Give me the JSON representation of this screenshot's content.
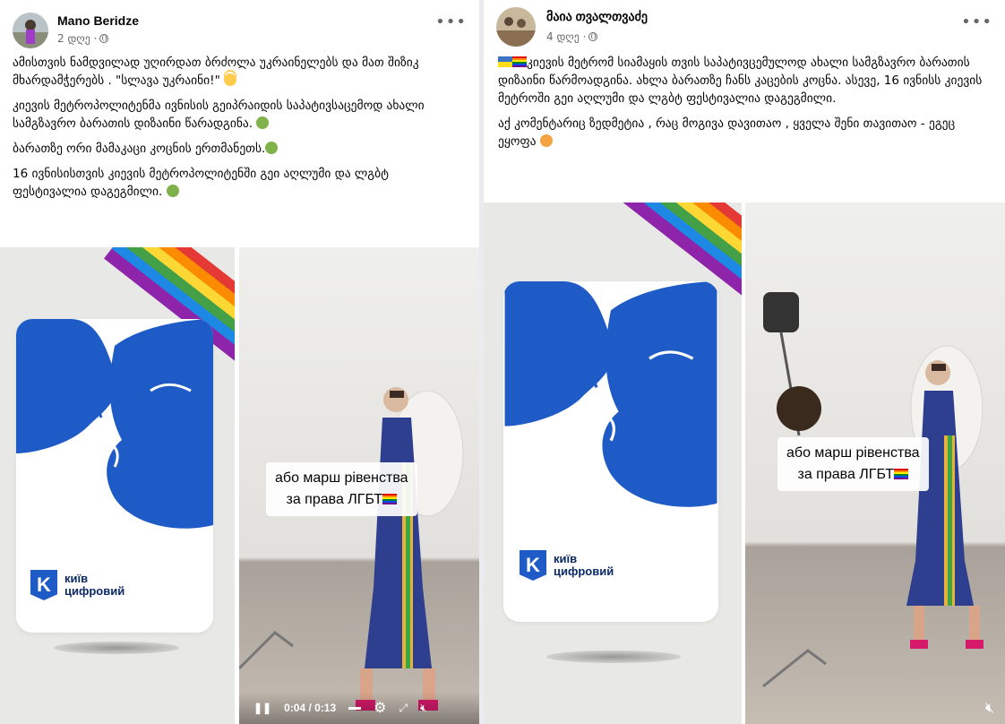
{
  "posts": [
    {
      "author": "Mano Beridze",
      "time": "2 დღე ·",
      "paragraphs": [
        "ამისთვის ნამდვილად  უღირდათ ბრძოლა უკრაინელებს და მათ  შიზიკ მხარდამჭერებს . \"სლავა  უკრაინი!\"",
        " კიევის მეტროპოლიტენმა ივნისის გეიპრაიდის საპატივსაცემოდ ახალი სამგზავრო ბარათის დიზაინი წარადგინა.",
        " ბარათზე ორი  მამაკაცი   კოცნის  ერთმანეთს.",
        " 16 ივნისისთვის  კიევის მეტროპოლიტენში  გეი აღლუმი და ლგბტ ფესტივალია დაგეგმილი."
      ],
      "caption_line1": "або марш рівенства",
      "caption_line2": "за права ЛГБТ",
      "logo_letter": "K",
      "logo_line1": "київ",
      "logo_line2": "цифровий",
      "video_time": "0:04 / 0:13"
    },
    {
      "author": "მაია თვალთვაძე",
      "time": "4 დღე ·",
      "paragraphs": [
        "კიევის მეტრომ სიამაყის თვის საპატივცემულოდ ახალი სამგზავრო ბარათის დიზაინი წარმოადგინა. ახლა ბარათზე ჩანს კაცების კოცნა. ასევე, 16 ივნისს კიევის მეტროში გეი აღლუმი და ლგბტ ფესტივალია დაგეგმილი.",
        "აქ კომენტარიც ზედმეტია , რაც მოგივა დავითაო , ყველა შენი თავითაო - ეგეც ეყოფა"
      ],
      "caption_line1": "або марш рівенства",
      "caption_line2": "за права ЛГБТ",
      "logo_letter": "K",
      "logo_line1": "київ",
      "logo_line2": "цифровий"
    }
  ],
  "icons": {
    "more": "more-options-icon",
    "privacy": "globe-icon",
    "play": "pause-icon",
    "settings": "gear-icon",
    "fullscreen": "fullscreen-icon",
    "volume": "muted-volume-icon"
  },
  "colors": {
    "brand_blue": "#1e5bc6",
    "bg": "#e9ebee"
  }
}
